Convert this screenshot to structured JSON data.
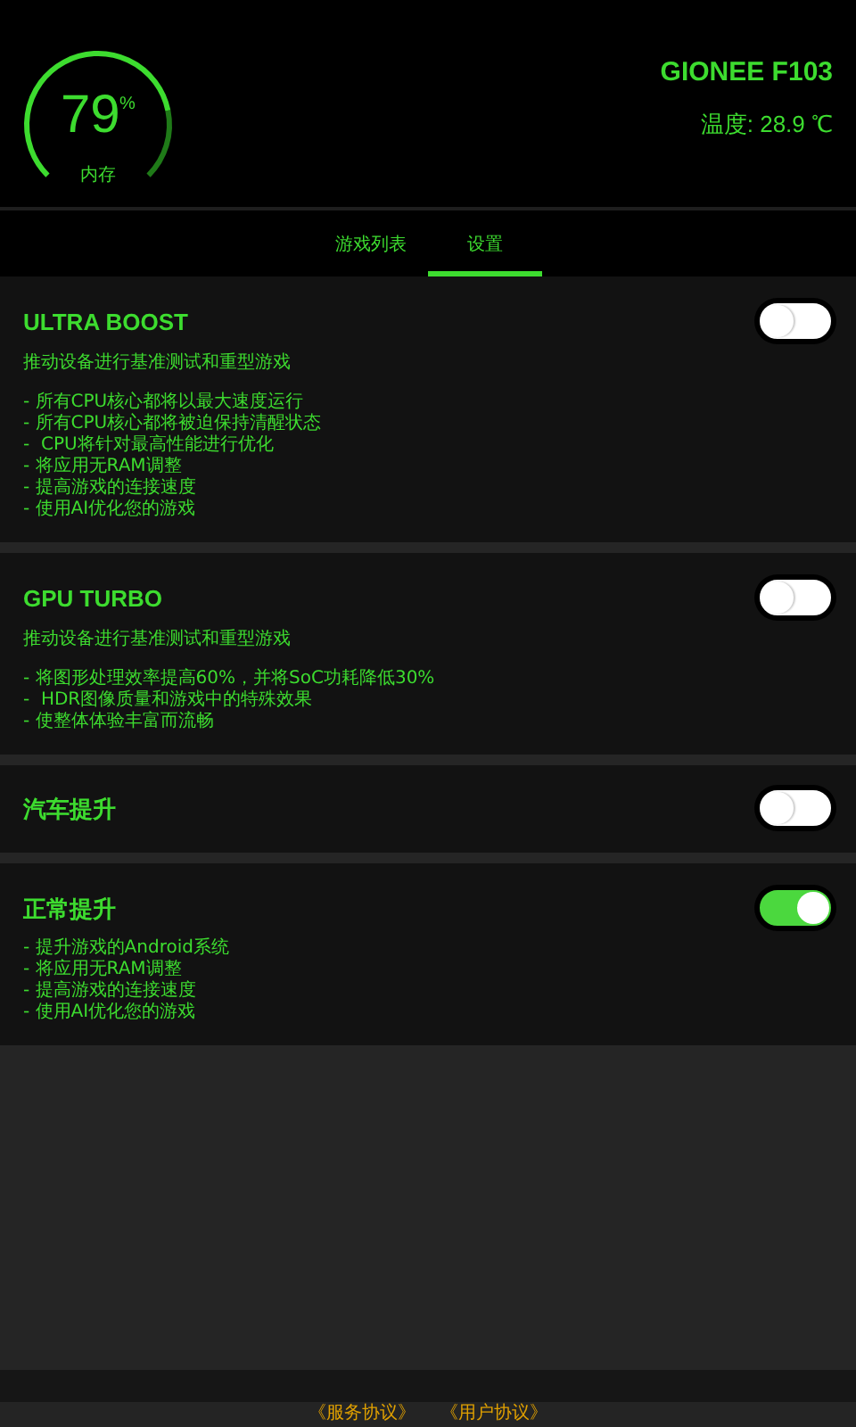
{
  "header": {
    "gauge": {
      "value": "79",
      "unit": "%",
      "label": "内存"
    },
    "device": "GIONEE F103",
    "temperature": "温度: 28.9 ℃"
  },
  "tabs": [
    {
      "label": "游戏列表",
      "selected": false
    },
    {
      "label": "设置",
      "selected": true
    }
  ],
  "cards": [
    {
      "title": "ULTRA BOOST",
      "description": "推动设备进行基准测试和重型游戏",
      "features": [
        "- 所有CPU核心都将以最大速度运行",
        "- 所有CPU核心都将被迫保持清醒状态",
        "-  CPU将针对最高性能进行优化",
        "- 将应用无RAM调整",
        "- 提高游戏的连接速度",
        "- 使用AI优化您的游戏"
      ],
      "on": false
    },
    {
      "title": "GPU TURBO",
      "description": "推动设备进行基准测试和重型游戏",
      "features": [
        "- 将图形处理效率提高60%，并将SoC功耗降低30%",
        "-  HDR图像质量和游戏中的特殊效果",
        "- 使整体体验丰富而流畅"
      ],
      "on": false
    },
    {
      "title": "汽车提升",
      "on": false
    },
    {
      "title": "正常提升",
      "features": [
        "- 提升游戏的Android系统",
        "- 将应用无RAM调整",
        "- 提高游戏的连接速度",
        "- 使用AI优化您的游戏"
      ],
      "on": true
    }
  ],
  "footer": {
    "links": [
      "《服务协议》",
      "《用户协议》"
    ]
  }
}
